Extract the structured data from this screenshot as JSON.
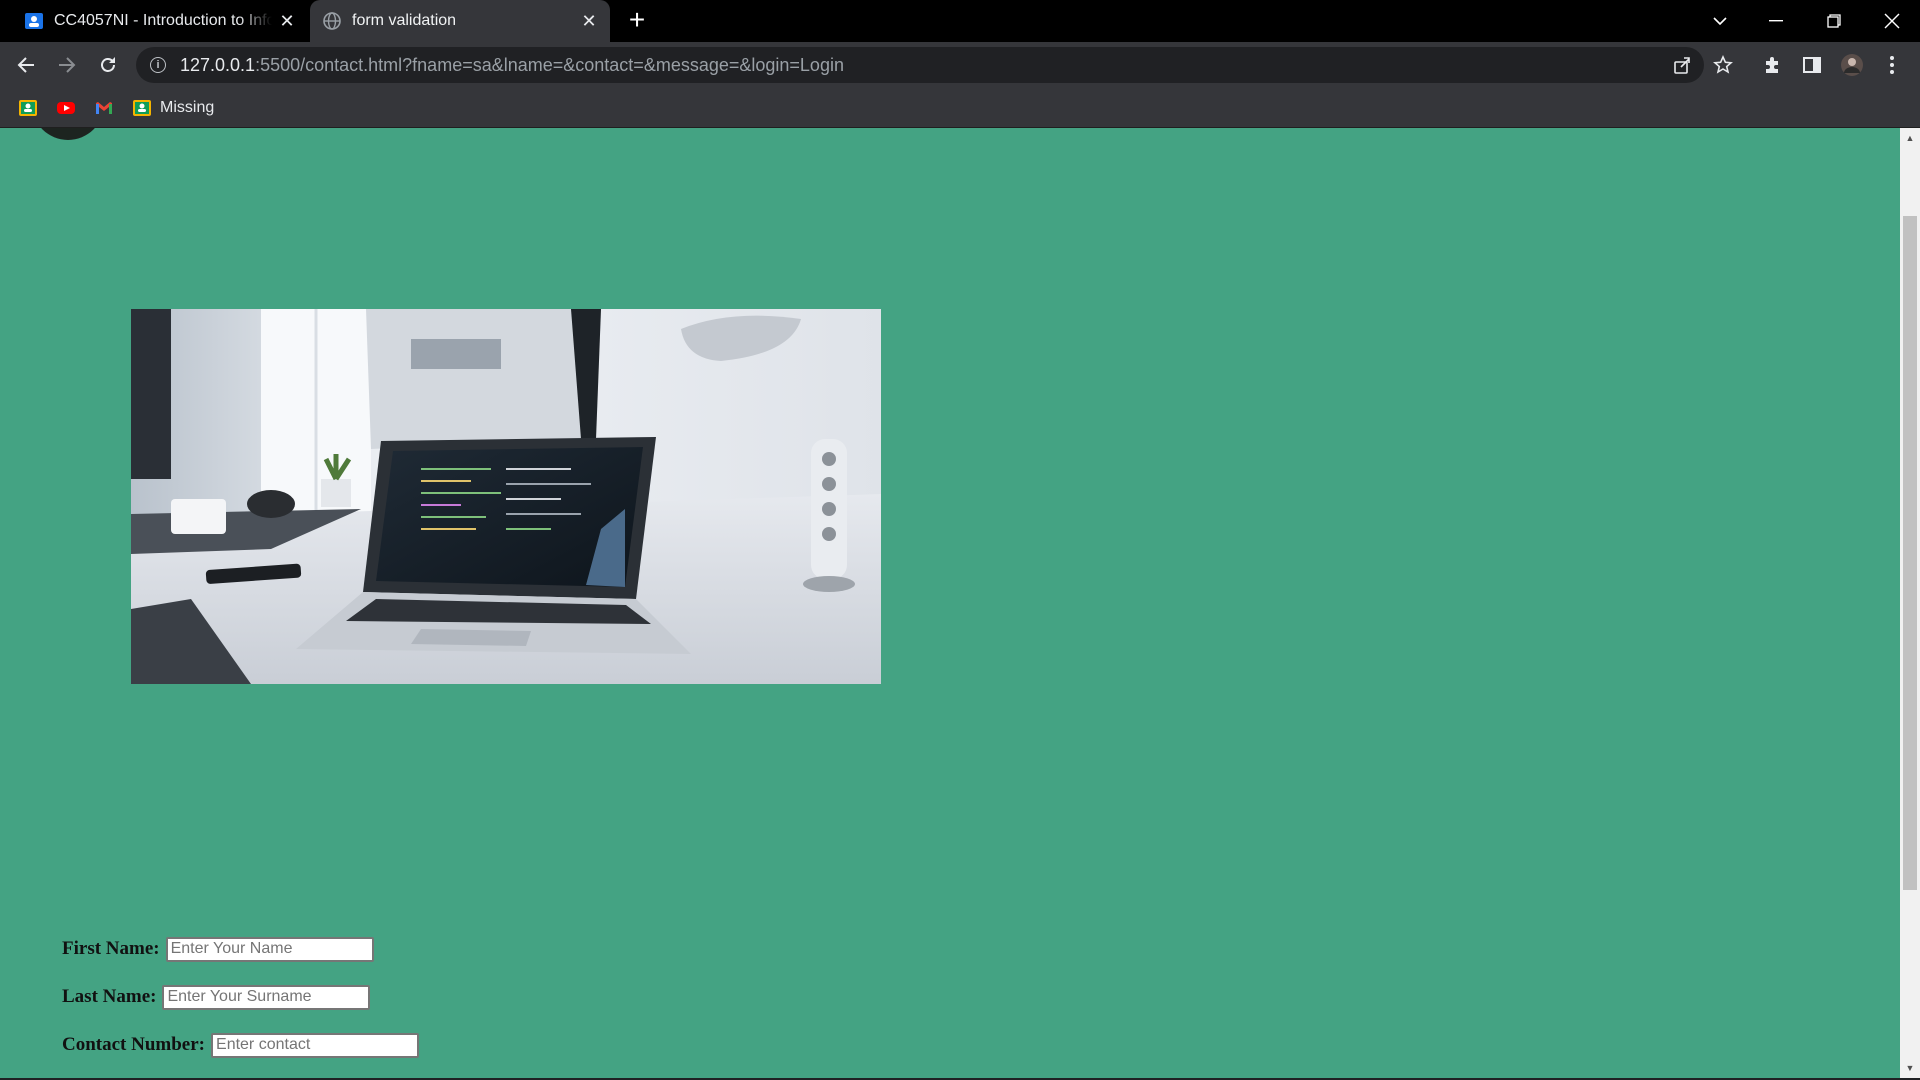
{
  "browser": {
    "tabs": [
      {
        "title": "CC4057NI - Introduction to Infor",
        "active": false
      },
      {
        "title": "form validation",
        "active": true
      }
    ],
    "url_host": "127.0.0.1",
    "url_rest": ":5500/contact.html?fname=sa&lname=&contact=&message=&login=Login",
    "bookmarks": [
      {
        "icon": "classroom-icon",
        "label": ""
      },
      {
        "icon": "youtube-icon",
        "label": ""
      },
      {
        "icon": "gmail-icon",
        "label": ""
      },
      {
        "icon": "classroom-icon",
        "label": "Missing"
      }
    ]
  },
  "page": {
    "background_color": "#44a383",
    "hero_image": "laptop-on-desk-photo",
    "form": {
      "first_name": {
        "label": "First Name:",
        "placeholder": "Enter Your Name",
        "value": ""
      },
      "last_name": {
        "label": "Last Name:",
        "placeholder": "Enter Your Surname",
        "value": ""
      },
      "contact": {
        "label": "Contact Number:",
        "placeholder": "Enter contact",
        "value": ""
      }
    }
  }
}
